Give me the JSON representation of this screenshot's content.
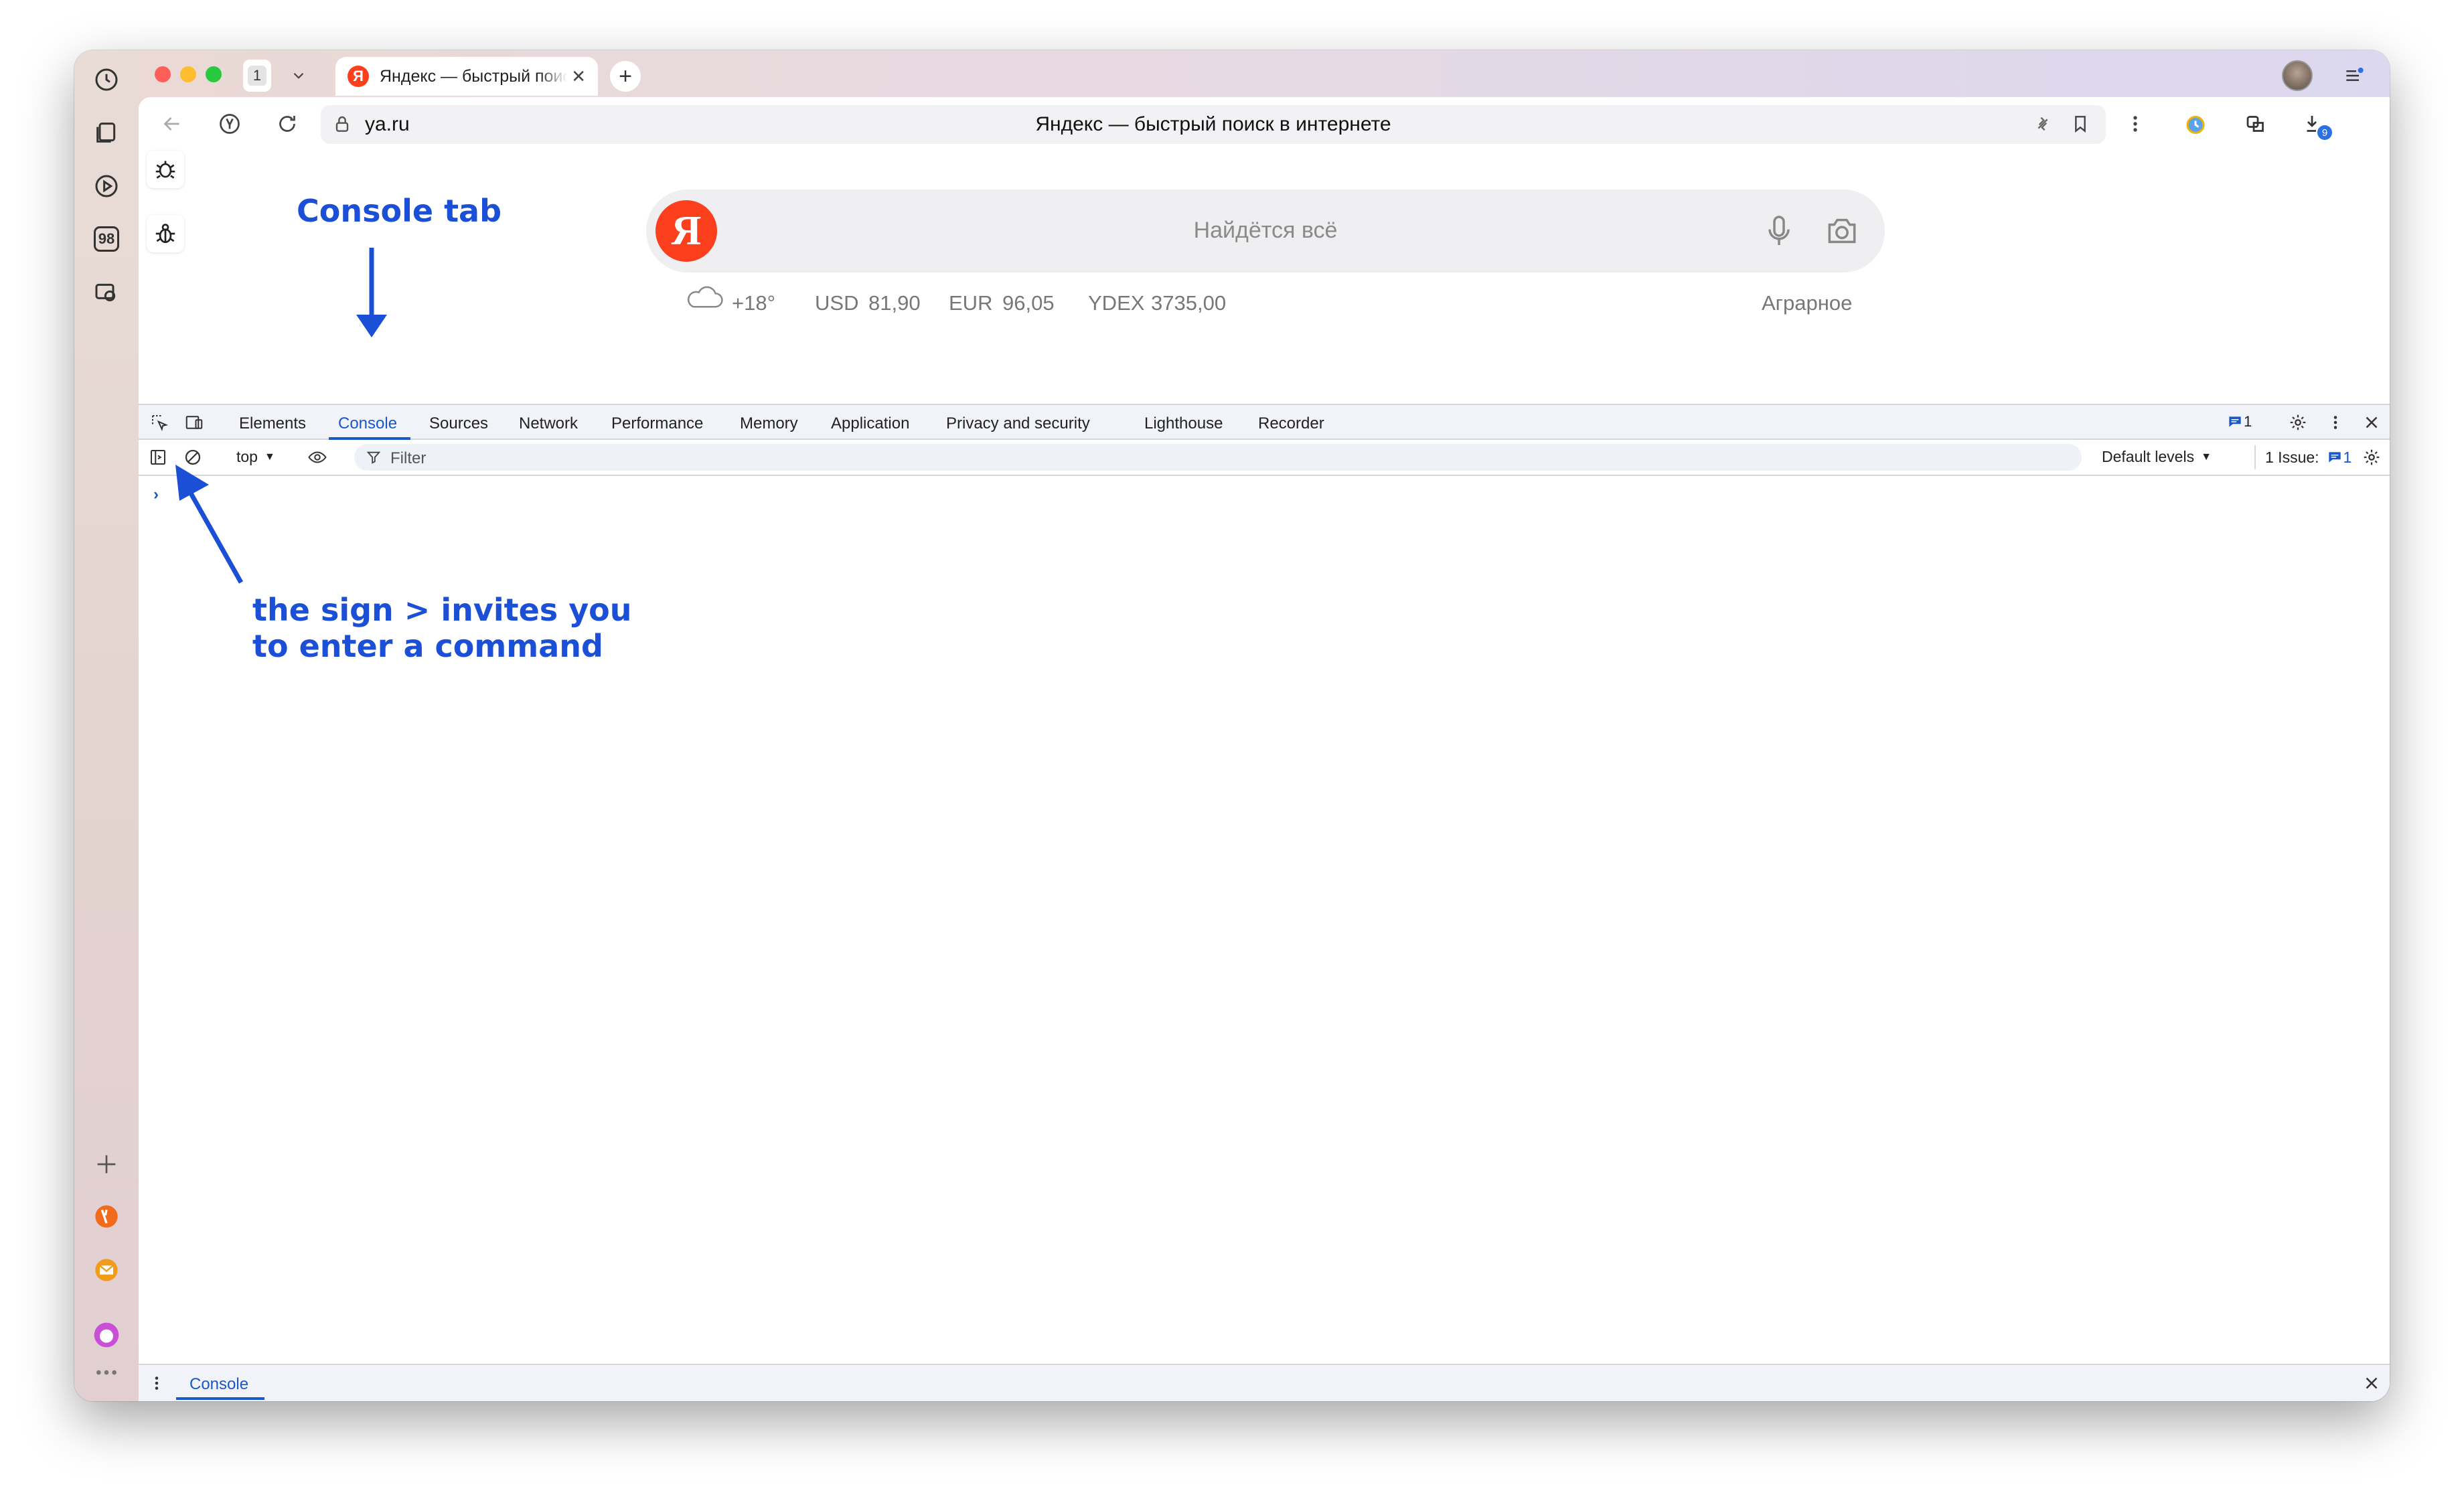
{
  "browser": {
    "tab_count": "1",
    "tab_title": "Яндекс — быстрый поиск в интернете",
    "new_tab": "+",
    "sidebar_badge": "98",
    "downloads_badge": "9"
  },
  "addressbar": {
    "url": "ya.ru",
    "page_title": "Яндекс — быстрый поиск в интернете"
  },
  "page": {
    "logo_letter": "Я",
    "search_placeholder": "Найдётся всё",
    "weather": "+18°",
    "rates": [
      {
        "label": "USD",
        "value": "81,90"
      },
      {
        "label": "EUR",
        "value": "96,05"
      },
      {
        "label": "YDEX",
        "value": "3735,00"
      }
    ],
    "location": "Аграрное"
  },
  "devtools": {
    "tabs": [
      "Elements",
      "Console",
      "Sources",
      "Network",
      "Performance",
      "Memory",
      "Application",
      "Privacy and security",
      "Lighthouse",
      "Recorder"
    ],
    "active_tab": "Console",
    "messages_count": "1",
    "context": "top",
    "filter_placeholder": "Filter",
    "levels": "Default levels",
    "issues_label": "1 Issue:",
    "issues_count": "1",
    "prompt": "›",
    "drawer_tab": "Console"
  },
  "annotations": {
    "console_tab": "Console tab",
    "sign_line1": "the sign > invites you",
    "sign_line2": "to enter a command"
  },
  "colors": {
    "accent": "#1a57c8",
    "annotation": "#1a4fd6",
    "yandex_red": "#fc3f1d"
  }
}
